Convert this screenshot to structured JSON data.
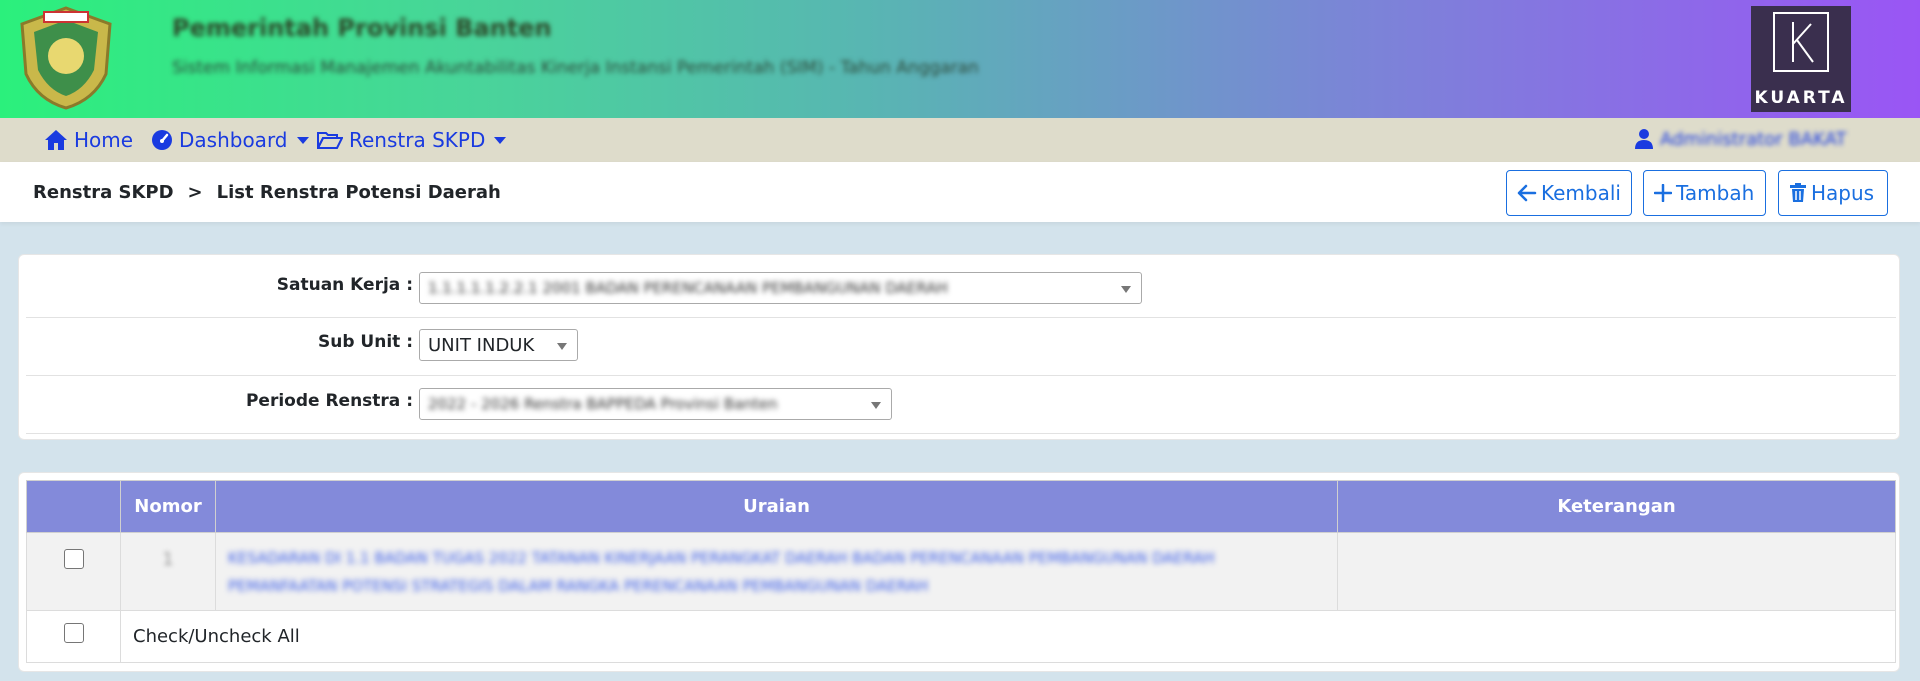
{
  "header": {
    "title": "Pemerintah Provinsi Banten",
    "subtitle": "Sistem Informasi Manajemen Akuntabilitas Kinerja Instansi Pemerintah (SIM) - Tahun Anggaran",
    "brand": "KUARTA"
  },
  "nav": {
    "home": "Home",
    "dashboard": "Dashboard",
    "renstra": "Renstra SKPD",
    "user": "Administrator BAKAT"
  },
  "breadcrumb": {
    "parent": "Renstra SKPD",
    "separator": ">",
    "current": "List Renstra Potensi Daerah"
  },
  "toolbar": {
    "kembali": "Kembali",
    "tambah": "Tambah",
    "hapus": "Hapus"
  },
  "filters": {
    "satuan_kerja_label": "Satuan Kerja :",
    "satuan_kerja_value": "1.1.1.1.1.2.2.1 2001 BADAN PERENCANAAN PEMBANGUNAN DAERAH",
    "sub_unit_label": "Sub Unit :",
    "sub_unit_value": "UNIT INDUK",
    "periode_label": "Periode Renstra :",
    "periode_value": "2022 - 2026 Renstra BAPPEDA Provinsi Banten"
  },
  "table": {
    "headers": [
      "",
      "Nomor",
      "Uraian",
      "Keterangan"
    ],
    "rows": [
      {
        "nomor": "1",
        "uraian": "KESADARAN DI 1.1 BADAN TUGAS 2022 TATANAN KINERJAAN PERANGKAT DAERAH BADAN PERENCANAAN PEMBANGUNAN DAERAH PEMANFAATAN POTENSI STRATEGIS DALAM RANGKA PERENCANAAN PEMBANGUNAN DAERAH",
        "keterangan": ""
      }
    ],
    "check_all_label": "Check/Uncheck All"
  },
  "colors": {
    "nav_link": "#1a3be0",
    "button": "#1a6fe0",
    "table_header": "#838ada",
    "navbar_bg": "#dedccb",
    "page_bg": "#d3e3ec"
  }
}
